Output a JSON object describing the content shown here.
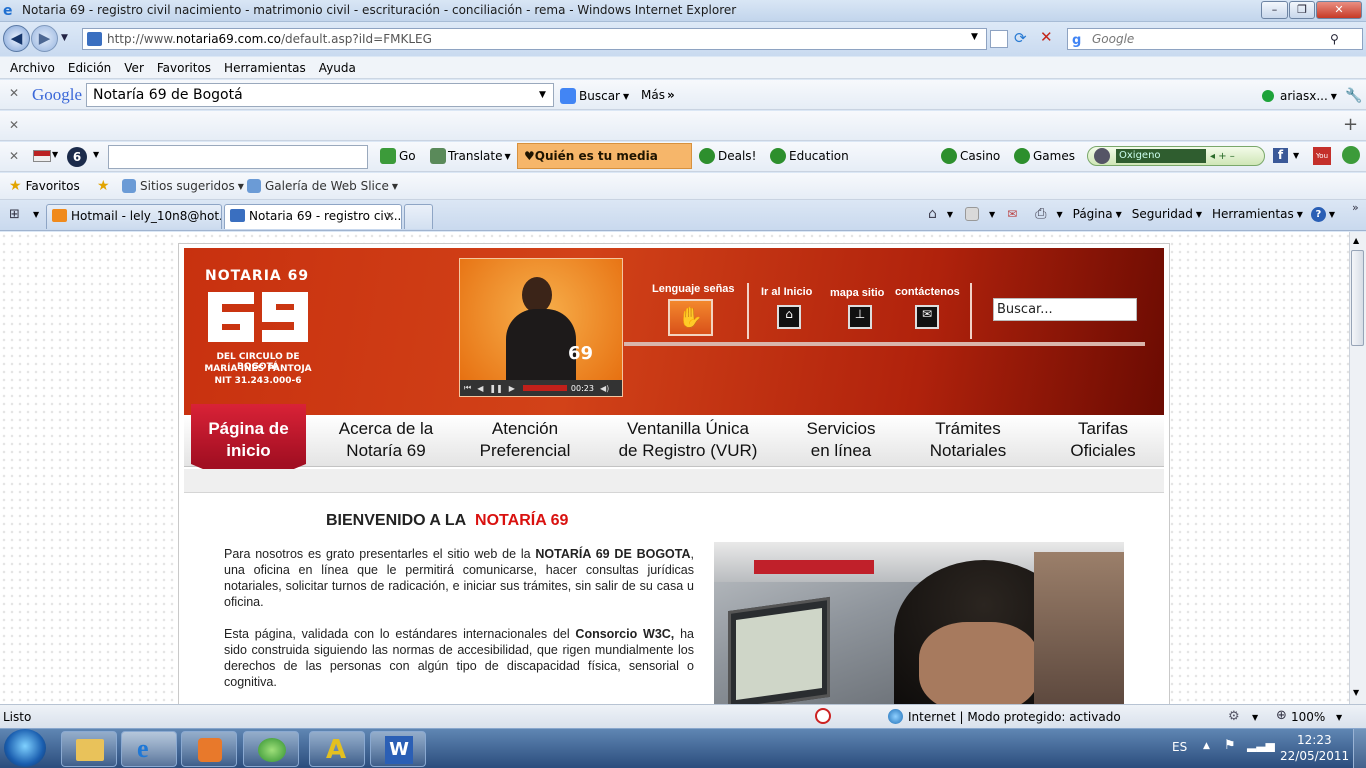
{
  "window": {
    "title": "Notaria 69 - registro civil nacimiento - matrimonio civil - escrituración - conciliación - rema - Windows Internet Explorer",
    "minimize": "–",
    "maximize": "❐",
    "close": "✕"
  },
  "address": {
    "url_prefix": "http://www.",
    "url_domain": "notaria69.com.co",
    "url_rest": "/default.asp?iId=FMKLEG",
    "search_placeholder": "Google"
  },
  "menu": [
    "Archivo",
    "Edición",
    "Ver",
    "Favoritos",
    "Herramientas",
    "Ayuda"
  ],
  "google_toolbar": {
    "logo": "Google",
    "query": "Notaría 69 de Bogotá",
    "search_label": "Buscar",
    "more_label": "Más",
    "account": "ariasx..."
  },
  "yahoo_toolbar": {
    "go": "Go",
    "translate": "Translate",
    "promo": "♥Quién es tu media naranjas",
    "deals": "Deals!",
    "education": "Education",
    "casino": "Casino",
    "games": "Games",
    "radio": "Oxigeno"
  },
  "favorites_bar": {
    "favorites": "Favoritos",
    "suggested": "Sitios sugeridos",
    "webslice": "Galería de Web Slice"
  },
  "tabs": [
    {
      "label": "Hotmail - lely_10n8@hot..."
    },
    {
      "label": "Notaria 69 - registro civ..."
    }
  ],
  "command_bar": {
    "page": "Página",
    "security": "Seguridad",
    "tools": "Herramientas"
  },
  "site": {
    "logo_title": "NOTARIA 69",
    "logo_number": "69",
    "logo_line1": "DEL CIRCULO DE BOGOTÁ",
    "logo_line2": "MARÍA INES PANTOJA",
    "logo_line3": "NIT  31.243.000-6",
    "video_time": "00:23",
    "video_logo": "69",
    "header_links": {
      "sign_language": "Lenguaje señas",
      "home": "Ir al Inicio",
      "sitemap": "mapa sitio",
      "contact": "contáctenos"
    },
    "search_placeholder": "Buscar...",
    "nav": [
      {
        "line1": "Página de",
        "line2": "inicio"
      },
      {
        "line1": "Acerca de la",
        "line2": "Notaría 69"
      },
      {
        "line1": "Atención",
        "line2": "Preferencial"
      },
      {
        "line1": "Ventanilla Única",
        "line2": "de Registro (VUR)"
      },
      {
        "line1": "Servicios",
        "line2": "en línea"
      },
      {
        "line1": "Trámites",
        "line2": "Notariales"
      },
      {
        "line1": "Tarifas",
        "line2": "Oficiales"
      }
    ],
    "welcome_prefix": "BIENVENIDO A LA",
    "welcome_name": "NOTARÍA 69",
    "p1_a": "Para nosotros es grato presentarles el sitio web de la ",
    "p1_b": "NOTARÍA 69 DE BOGOTA",
    "p1_c": ", una oficina en línea que le permitirá comunicarse, hacer consultas jurídicas notariales, solicitar turnos de radicación, e iniciar sus trámites, sin salir de su casa u oficina.",
    "p2_a": "Esta página, validada con lo estándares  internacionales del ",
    "p2_b": "Consorcio W3C,",
    "p2_c": " ha sido construida siguiendo las normas de accesibilidad, que rigen mundialmente los derechos de las personas con algún tipo de discapacidad física, sensorial o cognitiva."
  },
  "status": {
    "text": "Listo",
    "zone": "Internet | Modo protegido: activado",
    "zoom": "100%"
  },
  "taskbar": {
    "lang": "ES",
    "time": "12:23",
    "date": "22/05/2011"
  },
  "colors": {
    "header_red": "#c8310f",
    "nav_active": "#d92237",
    "welcome_red": "#d9110f"
  }
}
